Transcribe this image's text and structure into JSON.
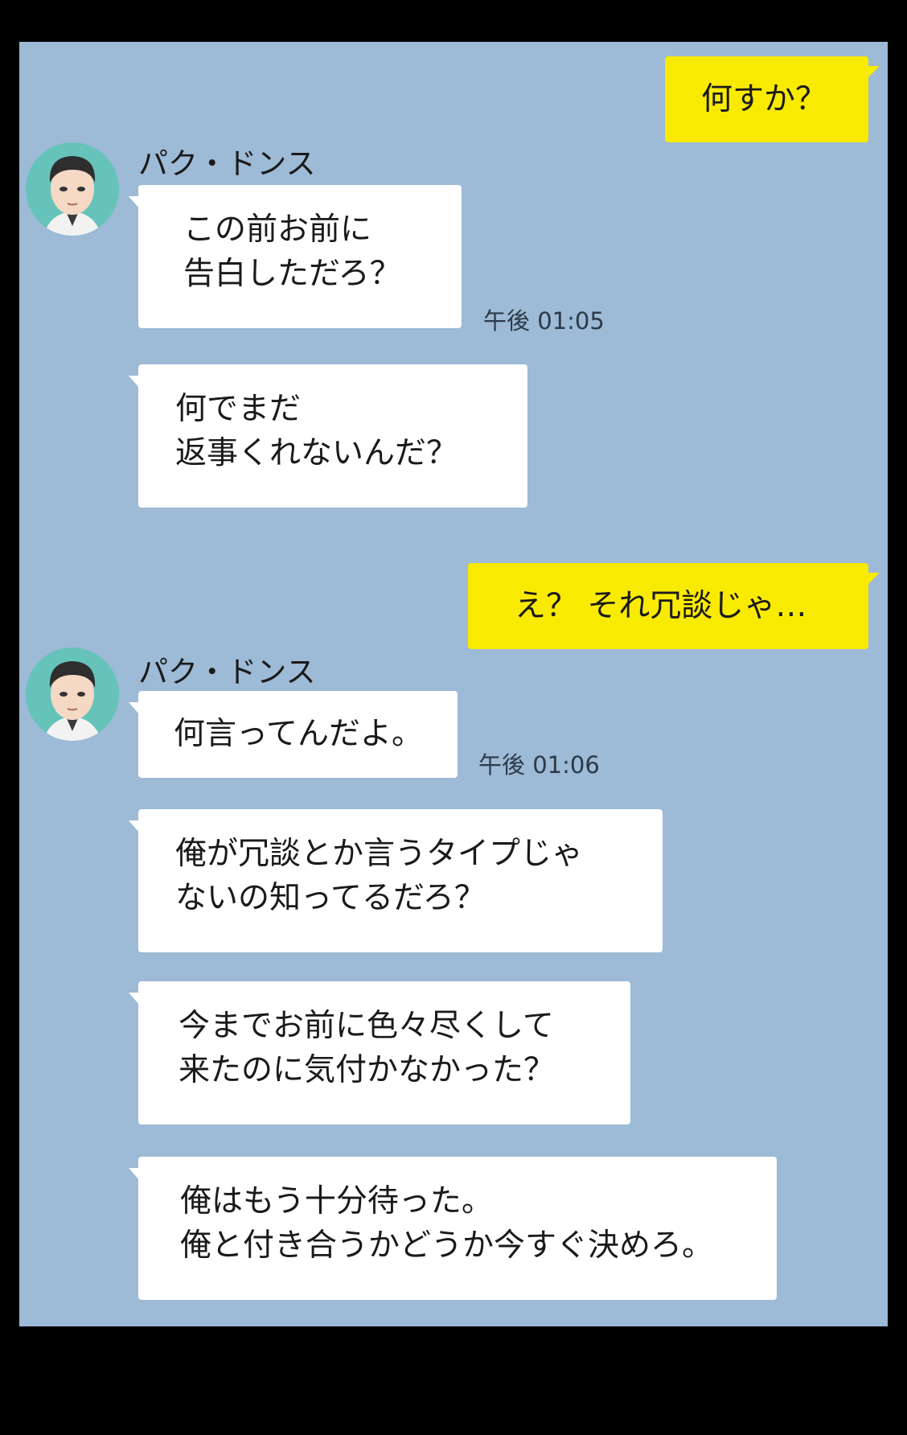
{
  "messages": [
    {
      "text": "何すか？"
    },
    {
      "sender": "パク・ドンス",
      "text": "この前お前に\n告白しただろ？",
      "time": "午後 01:05"
    },
    {
      "text": "何でまだ\n返事くれないんだ？"
    },
    {
      "text": "え？ それ冗談じゃ…"
    },
    {
      "sender": "パク・ドンス",
      "text": "何言ってんだよ。",
      "time": "午後 01:06"
    },
    {
      "text": "俺が冗談とか言うタイプじゃ\nないの知ってるだろ？"
    },
    {
      "text": "今までお前に色々尽くして\n来たのに気付かなかった？"
    },
    {
      "text": "俺はもう十分待った。\n俺と付き合うかどうか今すぐ決めろ。"
    }
  ],
  "colors": {
    "background": "#9dbad6",
    "outgoing_bubble": "#f9ea02",
    "incoming_bubble": "#ffffff",
    "avatar_bg": "#66c3ba"
  },
  "icons": {
    "avatar": "man-portrait-avatar"
  }
}
